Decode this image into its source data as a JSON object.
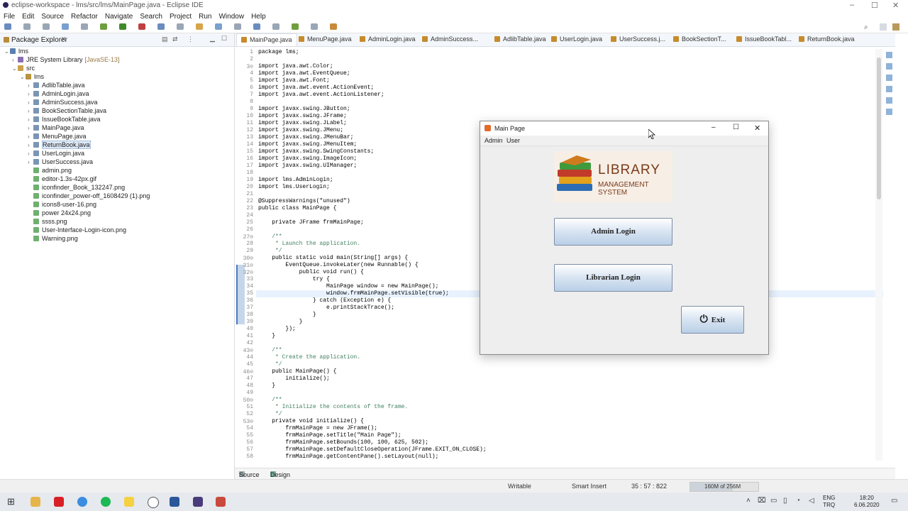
{
  "window": {
    "title": "eclipse-workspace - lms/src/lms/MainPage.java - Eclipse IDE"
  },
  "menu": [
    "File",
    "Edit",
    "Source",
    "Refactor",
    "Navigate",
    "Search",
    "Project",
    "Run",
    "Window",
    "Help"
  ],
  "package_explorer": {
    "title": "Package Explorer",
    "items": [
      {
        "label": "lms",
        "level": 0,
        "icon": "project-icon"
      },
      {
        "label": "JRE System Library",
        "suffix": "[JavaSE-13]",
        "level": 1,
        "icon": "library-icon"
      },
      {
        "label": "src",
        "level": 1,
        "icon": "folder-icon"
      },
      {
        "label": "lms",
        "level": 2,
        "icon": "package-icon"
      },
      {
        "label": "AdlibTable.java",
        "level": 3,
        "icon": "java-file-icon"
      },
      {
        "label": "AdminLogin.java",
        "level": 3,
        "icon": "java-file-icon"
      },
      {
        "label": "AdminSuccess.java",
        "level": 3,
        "icon": "java-file-icon"
      },
      {
        "label": "BookSectionTable.java",
        "level": 3,
        "icon": "java-file-icon"
      },
      {
        "label": "IssueBookTable.java",
        "level": 3,
        "icon": "java-file-icon"
      },
      {
        "label": "MainPage.java",
        "level": 3,
        "icon": "java-file-icon"
      },
      {
        "label": "MenuPage.java",
        "level": 3,
        "icon": "java-file-icon"
      },
      {
        "label": "ReturnBook.java",
        "level": 3,
        "icon": "java-file-icon",
        "selected": true
      },
      {
        "label": "UserLogin.java",
        "level": 3,
        "icon": "java-file-icon"
      },
      {
        "label": "UserSuccess.java",
        "level": 3,
        "icon": "java-file-icon"
      },
      {
        "label": "admin.png",
        "level": 3,
        "icon": "image-file-icon"
      },
      {
        "label": "editor-1.3s-42px.gif",
        "level": 3,
        "icon": "image-file-icon"
      },
      {
        "label": "iconfinder_Book_132247.png",
        "level": 3,
        "icon": "image-file-icon"
      },
      {
        "label": "iconfinder_power-off_1608429 (1).png",
        "level": 3,
        "icon": "image-file-icon"
      },
      {
        "label": "icons8-user-16.png",
        "level": 3,
        "icon": "image-file-icon"
      },
      {
        "label": "power 24x24.png",
        "level": 3,
        "icon": "image-file-icon"
      },
      {
        "label": "ssss.png",
        "level": 3,
        "icon": "image-file-icon"
      },
      {
        "label": "User-Interface-Login-icon.png",
        "level": 3,
        "icon": "image-file-icon"
      },
      {
        "label": "Warning.png",
        "level": 3,
        "icon": "image-file-icon"
      }
    ]
  },
  "editor": {
    "tabs": [
      "MainPage.java",
      "MenuPage.java",
      "AdminLogin.java",
      "AdminSuccess...",
      "AdlibTable.java",
      "UserLogin.java",
      "UserSuccess.j...",
      "BookSectionT...",
      "IssueBookTabl...",
      "ReturnBook.java"
    ],
    "lines": [
      {
        "n": "1",
        "t": "package lms;"
      },
      {
        "n": "2",
        "t": ""
      },
      {
        "n": "3⊖",
        "t": "import java.awt.Color;"
      },
      {
        "n": "4",
        "t": "import java.awt.EventQueue;"
      },
      {
        "n": "5",
        "t": "import java.awt.Font;"
      },
      {
        "n": "6",
        "t": "import java.awt.event.ActionEvent;"
      },
      {
        "n": "7",
        "t": "import java.awt.event.ActionListener;"
      },
      {
        "n": "8",
        "t": ""
      },
      {
        "n": "9",
        "t": "import javax.swing.JButton;"
      },
      {
        "n": "10",
        "t": "import javax.swing.JFrame;"
      },
      {
        "n": "11",
        "t": "import javax.swing.JLabel;"
      },
      {
        "n": "12",
        "t": "import javax.swing.JMenu;"
      },
      {
        "n": "13",
        "t": "import javax.swing.JMenuBar;"
      },
      {
        "n": "14",
        "t": "import javax.swing.JMenuItem;"
      },
      {
        "n": "15",
        "t": "import javax.swing.SwingConstants;"
      },
      {
        "n": "16",
        "t": "import javax.swing.ImageIcon;"
      },
      {
        "n": "17",
        "t": "import javax.swing.UIManager;"
      },
      {
        "n": "18",
        "t": ""
      },
      {
        "n": "19",
        "t": "import lms.AdminLogin;"
      },
      {
        "n": "20",
        "t": "import lms.UserLogin;"
      },
      {
        "n": "21",
        "t": ""
      },
      {
        "n": "22",
        "t": "@SuppressWarnings(\"unused\")"
      },
      {
        "n": "23",
        "t": "public class MainPage {"
      },
      {
        "n": "24",
        "t": ""
      },
      {
        "n": "25",
        "t": "    private JFrame frmMainPage;"
      },
      {
        "n": "26",
        "t": ""
      },
      {
        "n": "27⊖",
        "t": "    /**"
      },
      {
        "n": "28",
        "t": "     * Launch the application."
      },
      {
        "n": "29",
        "t": "     */"
      },
      {
        "n": "30⊖",
        "t": "    public static void main(String[] args) {"
      },
      {
        "n": "31⊖",
        "t": "        EventQueue.invokeLater(new Runnable() {"
      },
      {
        "n": "32⊖",
        "t": "            public void run() {"
      },
      {
        "n": "33",
        "t": "                try {"
      },
      {
        "n": "34",
        "t": "                    MainPage window = new MainPage();"
      },
      {
        "n": "35",
        "t": "                    window.frmMainPage.setVisible(true);"
      },
      {
        "n": "36",
        "t": "                } catch (Exception e) {"
      },
      {
        "n": "37",
        "t": "                    e.printStackTrace();"
      },
      {
        "n": "38",
        "t": "                }"
      },
      {
        "n": "39",
        "t": "            }"
      },
      {
        "n": "40",
        "t": "        });"
      },
      {
        "n": "41",
        "t": "    }"
      },
      {
        "n": "42",
        "t": ""
      },
      {
        "n": "43⊖",
        "t": "    /**"
      },
      {
        "n": "44",
        "t": "     * Create the application."
      },
      {
        "n": "45",
        "t": "     */"
      },
      {
        "n": "46⊖",
        "t": "    public MainPage() {"
      },
      {
        "n": "47",
        "t": "        initialize();"
      },
      {
        "n": "48",
        "t": "    }"
      },
      {
        "n": "49",
        "t": ""
      },
      {
        "n": "50⊖",
        "t": "    /**"
      },
      {
        "n": "51",
        "t": "     * Initialize the contents of the frame."
      },
      {
        "n": "52",
        "t": "     */"
      },
      {
        "n": "53⊖",
        "t": "    private void initialize() {"
      },
      {
        "n": "54",
        "t": "        frmMainPage = new JFrame();"
      },
      {
        "n": "55",
        "t": "        frmMainPage.setTitle(\"Main Page\");"
      },
      {
        "n": "56",
        "t": "        frmMainPage.setBounds(100, 100, 625, 502);"
      },
      {
        "n": "57",
        "t": "        frmMainPage.setDefaultCloseOperation(JFrame.EXIT_ON_CLOSE);"
      },
      {
        "n": "58",
        "t": "        frmMainPage.getContentPane().setLayout(null);"
      }
    ],
    "bottom_tabs": [
      "Source",
      "Design"
    ]
  },
  "status": {
    "writable": "Writable",
    "insert": "Smart Insert",
    "position": "35 : 57 : 822",
    "heap": "160M of 256M"
  },
  "tray": {
    "lang_top": "ENG",
    "lang_bottom": "TRQ",
    "time": "18:20",
    "date": "6.06.2020"
  },
  "app_window": {
    "title": "Main Page",
    "menu": [
      "Admin",
      "User"
    ],
    "logo_line1": "LIBRARY",
    "logo_line2": "MANAGEMENT SYSTEM",
    "admin_button": "Admin Login",
    "librarian_button": "Librarian Login",
    "exit_button": "Exit"
  }
}
